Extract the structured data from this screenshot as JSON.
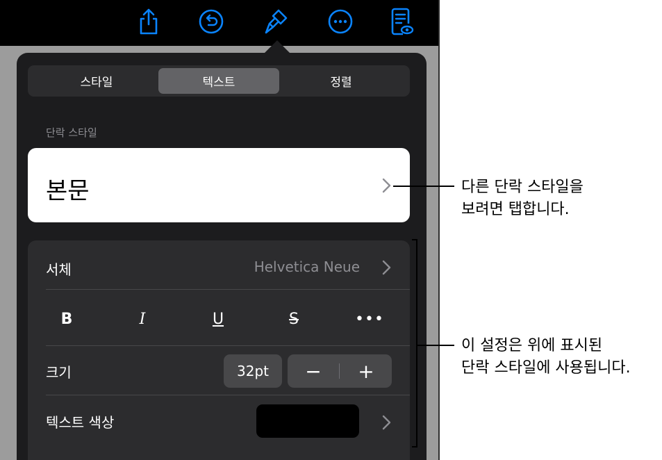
{
  "toolbar": {
    "icons": [
      "share-icon",
      "undo-icon",
      "format-brush-icon",
      "more-icon",
      "reader-view-icon"
    ]
  },
  "segmented": {
    "items": [
      "스타일",
      "텍스트",
      "정렬"
    ],
    "selected": "텍스트"
  },
  "paragraph": {
    "caption": "단락 스타일",
    "value": "본문"
  },
  "font": {
    "label": "서체",
    "value": "Helvetica Neue"
  },
  "styles": {
    "bold": "B",
    "italic": "I",
    "underline": "U",
    "strike": "S",
    "more": "•••"
  },
  "size": {
    "label": "크기",
    "value": "32pt",
    "minus": "−",
    "plus": "+"
  },
  "color": {
    "label": "텍스트 색상",
    "swatch": "#000000"
  },
  "callouts": {
    "top_line1": "다른 단락 스타일을",
    "top_line2": "보려면 탭합니다.",
    "bottom_line1": "이 설정은 위에 표시된",
    "bottom_line2": "단락 스타일에 사용됩니다."
  },
  "colors": {
    "accent": "#0a84ff",
    "panel": "#1c1c1e",
    "card": "#2c2c2e"
  }
}
